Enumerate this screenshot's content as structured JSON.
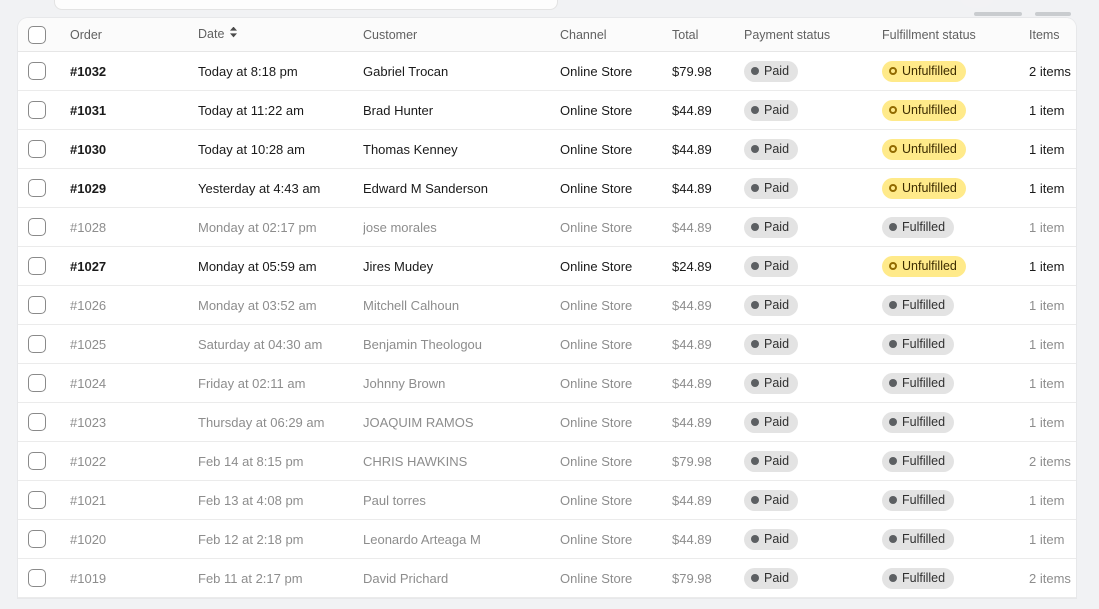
{
  "top_bar": {
    "search_placeholder": "",
    "search_value": ""
  },
  "table": {
    "columns": {
      "order": "Order",
      "date": "Date",
      "customer": "Customer",
      "channel": "Channel",
      "total": "Total",
      "payment_status": "Payment status",
      "fulfillment_status": "Fulfillment status",
      "items": "Items"
    },
    "sort_column": "Date",
    "sort_icon": "sort-both-icon",
    "colors": {
      "attention_badge_bg": "#ffea8a",
      "attention_badge_text": "#3d2c00",
      "default_badge_bg": "#e3e3e3",
      "default_badge_text": "#303030",
      "page_background": "#f1f2f4",
      "card_background": "#ffffff"
    },
    "rows": [
      {
        "order": "#1032",
        "date": "Today at 8:18 pm",
        "customer": "Gabriel Trocan",
        "channel": "Online Store",
        "total": "$79.98",
        "payment_status": "Paid",
        "payment_icon": "dot-filled-icon",
        "fulfillment_status": "Unfulfilled",
        "fulfillment_icon": "dot-ring-icon",
        "fulfillment_style": "attention",
        "items": "2 items",
        "unread": true
      },
      {
        "order": "#1031",
        "date": "Today at 11:22 am",
        "customer": "Brad Hunter",
        "channel": "Online Store",
        "total": "$44.89",
        "payment_status": "Paid",
        "payment_icon": "dot-filled-icon",
        "fulfillment_status": "Unfulfilled",
        "fulfillment_icon": "dot-ring-icon",
        "fulfillment_style": "attention",
        "items": "1 item",
        "unread": true
      },
      {
        "order": "#1030",
        "date": "Today at 10:28 am",
        "customer": "Thomas Kenney",
        "channel": "Online Store",
        "total": "$44.89",
        "payment_status": "Paid",
        "payment_icon": "dot-filled-icon",
        "fulfillment_status": "Unfulfilled",
        "fulfillment_icon": "dot-ring-icon",
        "fulfillment_style": "attention",
        "items": "1 item",
        "unread": true
      },
      {
        "order": "#1029",
        "date": "Yesterday at 4:43 am",
        "customer": "Edward M Sanderson",
        "channel": "Online Store",
        "total": "$44.89",
        "payment_status": "Paid",
        "payment_icon": "dot-filled-icon",
        "fulfillment_status": "Unfulfilled",
        "fulfillment_icon": "dot-ring-icon",
        "fulfillment_style": "attention",
        "items": "1 item",
        "unread": true
      },
      {
        "order": "#1028",
        "date": "Monday at 02:17 pm",
        "customer": "jose morales",
        "channel": "Online Store",
        "total": "$44.89",
        "payment_status": "Paid",
        "payment_icon": "dot-filled-icon",
        "fulfillment_status": "Fulfilled",
        "fulfillment_icon": "dot-filled-icon",
        "fulfillment_style": "default",
        "items": "1 item",
        "unread": false
      },
      {
        "order": "#1027",
        "date": "Monday at 05:59 am",
        "customer": "Jires Mudey",
        "channel": "Online Store",
        "total": "$24.89",
        "payment_status": "Paid",
        "payment_icon": "dot-filled-icon",
        "fulfillment_status": "Unfulfilled",
        "fulfillment_icon": "dot-ring-icon",
        "fulfillment_style": "attention",
        "items": "1 item",
        "unread": true
      },
      {
        "order": "#1026",
        "date": "Monday at 03:52 am",
        "customer": "Mitchell Calhoun",
        "channel": "Online Store",
        "total": "$44.89",
        "payment_status": "Paid",
        "payment_icon": "dot-filled-icon",
        "fulfillment_status": "Fulfilled",
        "fulfillment_icon": "dot-filled-icon",
        "fulfillment_style": "default",
        "items": "1 item",
        "unread": false
      },
      {
        "order": "#1025",
        "date": "Saturday at 04:30 am",
        "customer": "Benjamin Theologou",
        "channel": "Online Store",
        "total": "$44.89",
        "payment_status": "Paid",
        "payment_icon": "dot-filled-icon",
        "fulfillment_status": "Fulfilled",
        "fulfillment_icon": "dot-filled-icon",
        "fulfillment_style": "default",
        "items": "1 item",
        "unread": false
      },
      {
        "order": "#1024",
        "date": "Friday at 02:11 am",
        "customer": "Johnny Brown",
        "channel": "Online Store",
        "total": "$44.89",
        "payment_status": "Paid",
        "payment_icon": "dot-filled-icon",
        "fulfillment_status": "Fulfilled",
        "fulfillment_icon": "dot-filled-icon",
        "fulfillment_style": "default",
        "items": "1 item",
        "unread": false
      },
      {
        "order": "#1023",
        "date": "Thursday at 06:29 am",
        "customer": "JOAQUIM RAMOS",
        "channel": "Online Store",
        "total": "$44.89",
        "payment_status": "Paid",
        "payment_icon": "dot-filled-icon",
        "fulfillment_status": "Fulfilled",
        "fulfillment_icon": "dot-filled-icon",
        "fulfillment_style": "default",
        "items": "1 item",
        "unread": false
      },
      {
        "order": "#1022",
        "date": "Feb 14 at 8:15 pm",
        "customer": "CHRIS HAWKINS",
        "channel": "Online Store",
        "total": "$79.98",
        "payment_status": "Paid",
        "payment_icon": "dot-filled-icon",
        "fulfillment_status": "Fulfilled",
        "fulfillment_icon": "dot-filled-icon",
        "fulfillment_style": "default",
        "items": "2 items",
        "unread": false
      },
      {
        "order": "#1021",
        "date": "Feb 13 at 4:08 pm",
        "customer": "Paul torres",
        "channel": "Online Store",
        "total": "$44.89",
        "payment_status": "Paid",
        "payment_icon": "dot-filled-icon",
        "fulfillment_status": "Fulfilled",
        "fulfillment_icon": "dot-filled-icon",
        "fulfillment_style": "default",
        "items": "1 item",
        "unread": false
      },
      {
        "order": "#1020",
        "date": "Feb 12 at 2:18 pm",
        "customer": "Leonardo Arteaga M",
        "channel": "Online Store",
        "total": "$44.89",
        "payment_status": "Paid",
        "payment_icon": "dot-filled-icon",
        "fulfillment_status": "Fulfilled",
        "fulfillment_icon": "dot-filled-icon",
        "fulfillment_style": "default",
        "items": "1 item",
        "unread": false
      },
      {
        "order": "#1019",
        "date": "Feb 11 at 2:17 pm",
        "customer": "David Prichard",
        "channel": "Online Store",
        "total": "$79.98",
        "payment_status": "Paid",
        "payment_icon": "dot-filled-icon",
        "fulfillment_status": "Fulfilled",
        "fulfillment_icon": "dot-filled-icon",
        "fulfillment_style": "default",
        "items": "2 items",
        "unread": false
      }
    ]
  }
}
